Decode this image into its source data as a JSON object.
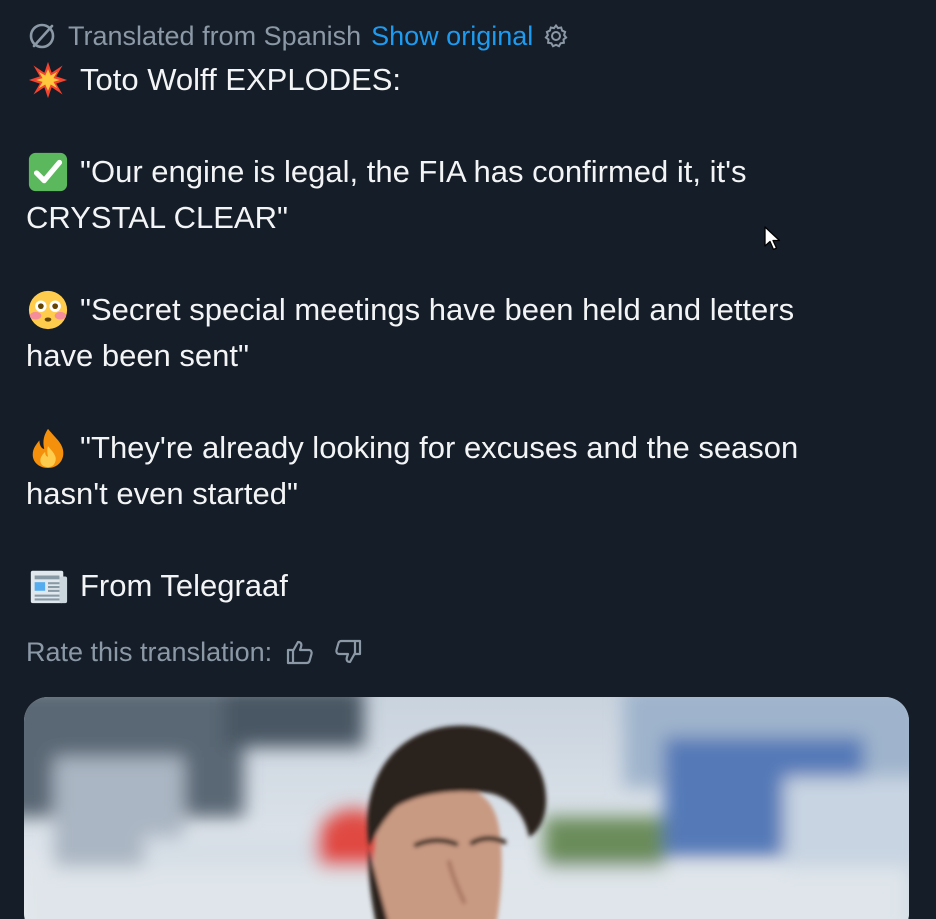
{
  "translation": {
    "label": "Translated from Spanish",
    "show_original": "Show original",
    "lang_icon": "translate-icon",
    "settings_icon": "gear-icon"
  },
  "post": {
    "headline_emoji": "collision-emoji",
    "headline": "Toto Wolff EXPLODES:",
    "quotes": [
      {
        "emoji": "check-mark-button-emoji",
        "line1": "\"Our engine is legal, the FIA has confirmed it, it's",
        "line2": "CRYSTAL CLEAR\""
      },
      {
        "emoji": "flushed-face-emoji",
        "line1": "\"Secret special meetings have been held and letters",
        "line2": "have been sent\""
      },
      {
        "emoji": "fire-emoji",
        "line1": "\"They're already looking for excuses and the season",
        "line2": "hasn't even started\""
      }
    ],
    "source_emoji": "newspaper-emoji",
    "source": "From Telegraaf"
  },
  "rating": {
    "label": "Rate this translation:",
    "up_icon": "thumbs-up-icon",
    "down_icon": "thumbs-down-icon"
  },
  "media": {
    "subject": "photo"
  },
  "colors": {
    "background": "#151d28",
    "text": "#f3f4f5",
    "muted": "#8b98a5",
    "link": "#1d9bf0"
  }
}
